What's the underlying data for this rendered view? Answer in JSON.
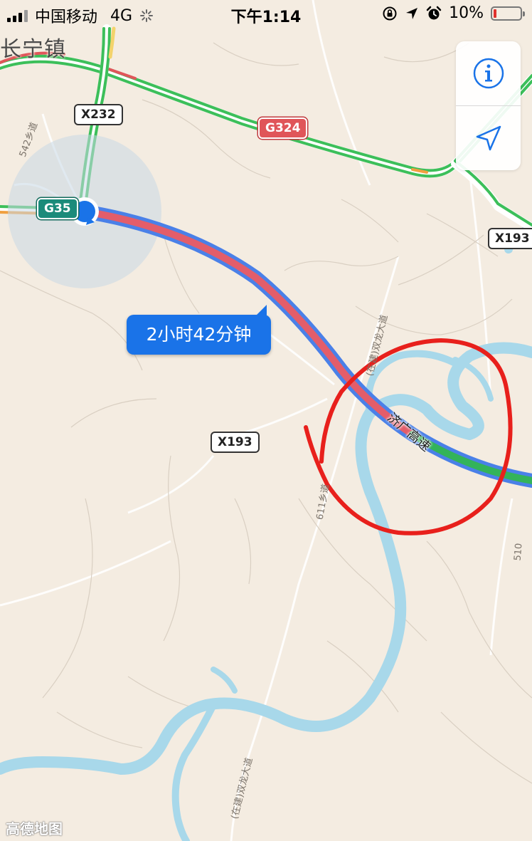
{
  "status_bar": {
    "carrier": "中国移动",
    "network": "4G",
    "time": "下午1:14",
    "battery_percent": "10%",
    "battery_level": 0.1,
    "icons": [
      "signal-bars-icon",
      "loading-spinner-icon",
      "orientation-lock-icon",
      "location-arrow-icon",
      "alarm-icon",
      "battery-icon"
    ]
  },
  "map": {
    "town_label": "长宁镇",
    "eta_label": "2小时42分钟",
    "shields": {
      "x232": "X232",
      "g324": "G324",
      "g35": "G35",
      "x193_right": "X193",
      "x193_left": "X193"
    },
    "road_labels": {
      "road_542": "542乡道",
      "road_611": "611乡道",
      "shuanglong_upper": "(在建)双龙大道",
      "shuanglong_lower": "(在建)双龙大道",
      "expressway": "济广高速",
      "road_510": "510"
    },
    "logo": "高德地图",
    "colors": {
      "land": "#f4ece1",
      "water": "#a8d8ea",
      "route_outline": "#4a80e8",
      "route_congested": "#e35d6a",
      "route_clear": "#33b35a",
      "traffic_green": "#3cbf5a",
      "traffic_red": "#e05559",
      "annotation_circle": "#e8201c",
      "accent_blue": "#1a73e8"
    }
  },
  "controls": {
    "info_button_icon": "info-icon",
    "locate_button_icon": "locate-arrow-icon"
  }
}
